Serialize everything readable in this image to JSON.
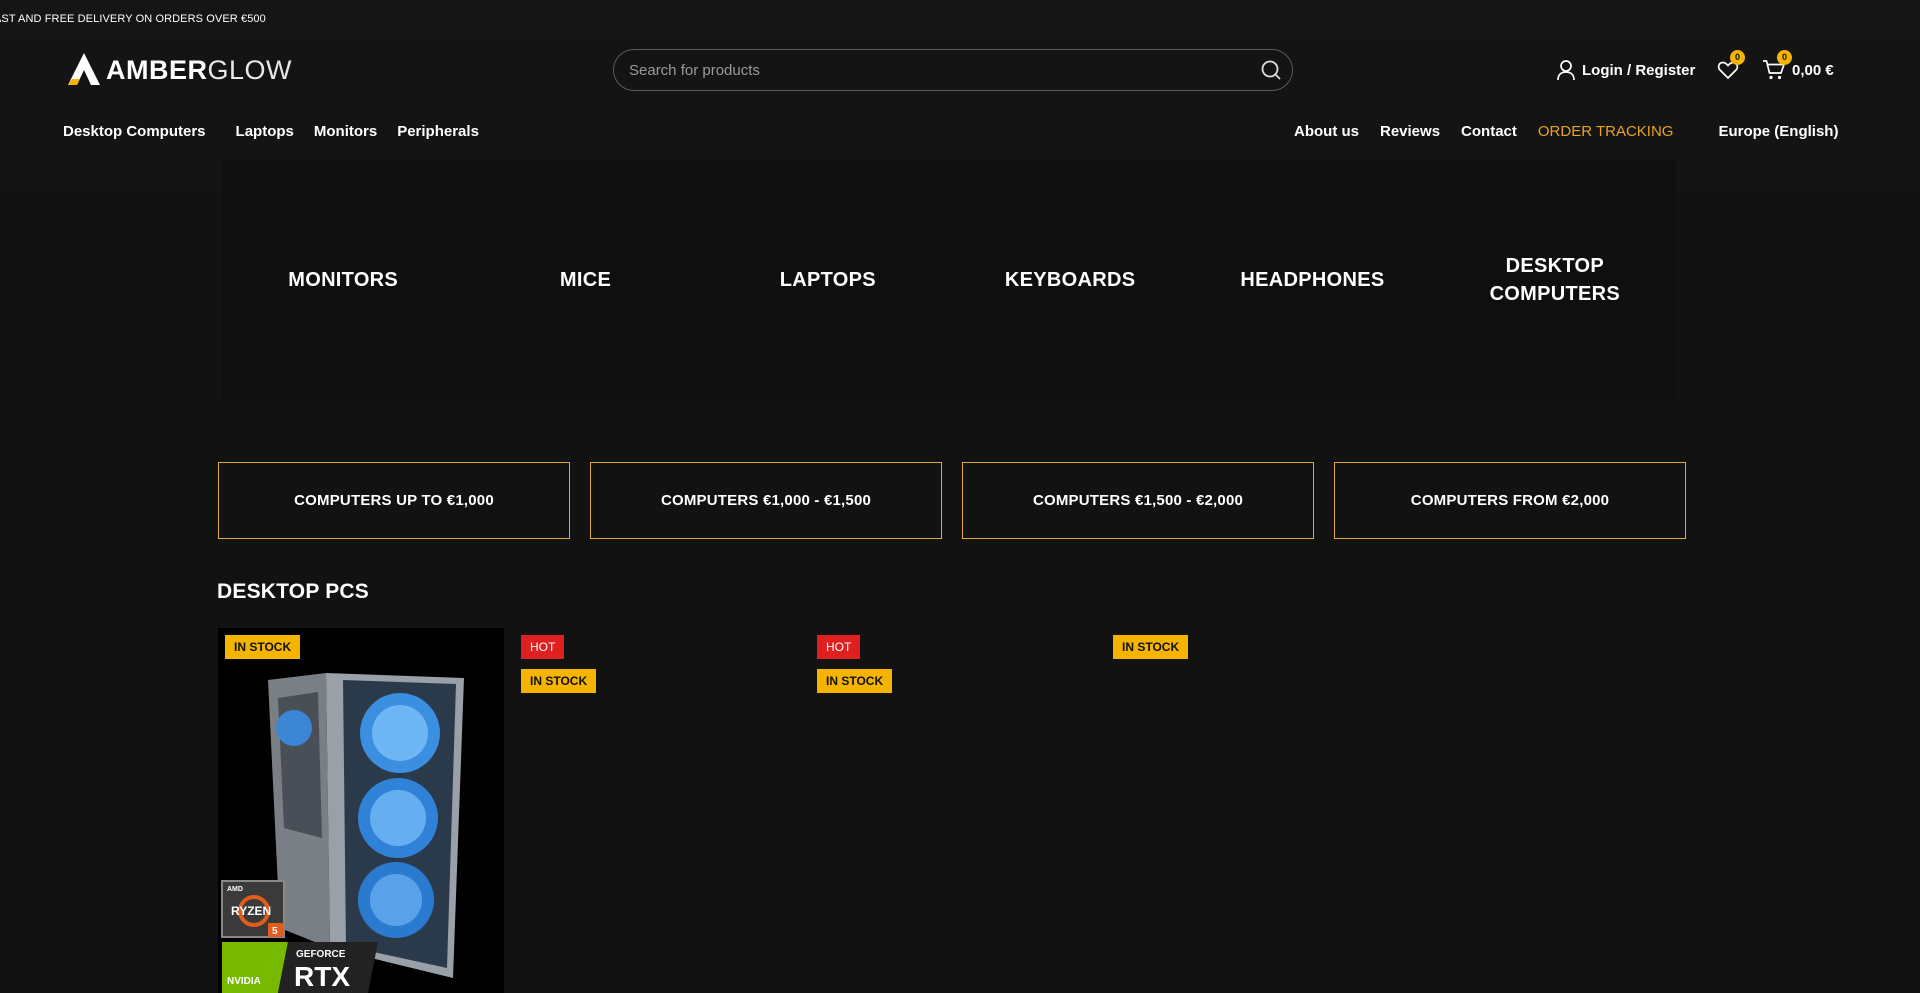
{
  "topbar": {
    "promo": "AST AND FREE DELIVERY ON ORDERS OVER €500"
  },
  "brand": {
    "name_bold": "AMBER",
    "name_light": "GLOW"
  },
  "search": {
    "placeholder": "Search for products"
  },
  "account": {
    "login_label": "Login / Register"
  },
  "wishlist": {
    "count": "0"
  },
  "cart": {
    "count": "0",
    "total": "0,00 €"
  },
  "nav_left": [
    "Desktop Computers",
    "Laptops",
    "Monitors",
    "Peripherals"
  ],
  "nav_right": {
    "about": "About us",
    "reviews": "Reviews",
    "contact": "Contact",
    "tracking": "ORDER TRACKING",
    "region": "Europe (English)"
  },
  "categories": [
    "MONITORS",
    "MICE",
    "LAPTOPS",
    "KEYBOARDS",
    "HEADPHONES",
    "DESKTOP\nCOMPUTERS"
  ],
  "price_ranges": [
    "COMPUTERS UP TO €1,000",
    "COMPUTERS €1,000 - €1,500",
    "COMPUTERS €1,500 - €2,000",
    "COMPUTERS FROM €2,000"
  ],
  "section": {
    "title": "DESKTOP PCS"
  },
  "products": [
    {
      "badges": [
        "IN STOCK"
      ],
      "image_labels": {
        "amd": "AMD",
        "ryzen": "RYZEN",
        "ryzen_tier": "5",
        "nvidia": "NVIDIA",
        "geforce": "GEFORCE",
        "rtx": "RTX"
      }
    },
    {
      "badges": [
        "HOT",
        "IN STOCK"
      ]
    },
    {
      "badges": [
        "HOT",
        "IN STOCK"
      ]
    },
    {
      "badges": [
        "IN STOCK"
      ]
    }
  ],
  "colors": {
    "accent": "#f5b400",
    "nav_highlight": "#e8a424",
    "hot": "#e02020",
    "range_border": "#e0a83a",
    "background": "#121212"
  }
}
